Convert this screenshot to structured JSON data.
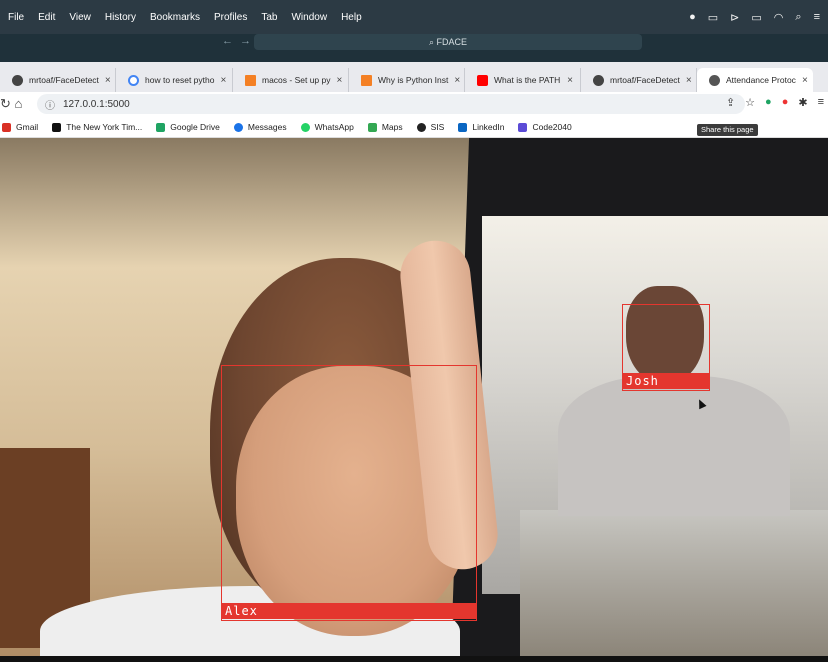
{
  "menubar": {
    "items": [
      "File",
      "Edit",
      "View",
      "History",
      "Bookmarks",
      "Profiles",
      "Tab",
      "Window",
      "Help"
    ]
  },
  "toolbar": {
    "search_text": "FDACE"
  },
  "tabs": [
    {
      "label": "mrtoaf/FaceDetect",
      "icon": "github-icon",
      "color": "#444444"
    },
    {
      "label": "how to reset pytho",
      "icon": "google-icon",
      "color": "#4285f4"
    },
    {
      "label": "macos - Set up py",
      "icon": "stackoverflow-icon",
      "color": "#f48024"
    },
    {
      "label": "Why is Python Inst",
      "icon": "stackoverflow-icon",
      "color": "#f48024"
    },
    {
      "label": "What is the PATH",
      "icon": "youtube-icon",
      "color": "#ff0000"
    },
    {
      "label": "mrtoaf/FaceDetect",
      "icon": "github-icon",
      "color": "#444444"
    },
    {
      "label": "Attendance Protoc",
      "icon": "globe-icon",
      "color": "#555555",
      "active": true
    }
  ],
  "address": {
    "url": "127.0.0.1:5000"
  },
  "bookmarks": [
    {
      "label": "Gmail",
      "color": "#d93025"
    },
    {
      "label": "The New York Tim...",
      "color": "#111111"
    },
    {
      "label": "Google Drive",
      "color": "#1fa463"
    },
    {
      "label": "Messages",
      "color": "#1a73e8"
    },
    {
      "label": "WhatsApp",
      "color": "#25d366"
    },
    {
      "label": "Maps",
      "color": "#34a853"
    },
    {
      "label": "SIS",
      "color": "#222222"
    },
    {
      "label": "LinkedIn",
      "color": "#0a66c2"
    },
    {
      "label": "Code2040",
      "color": "#5b4bd6"
    }
  ],
  "tooltip": "Share this page",
  "detections": {
    "box_color": "#e4362e",
    "faces": [
      {
        "name": "Alex"
      },
      {
        "name": "Josh"
      }
    ]
  }
}
